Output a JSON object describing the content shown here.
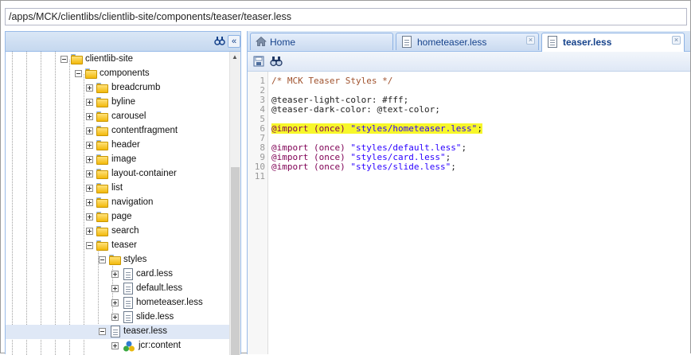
{
  "path": "/apps/MCK/clientlibs/clientlib-site/components/teaser/teaser.less",
  "tree": {
    "root_label": "clientlib-site",
    "components_label": "components",
    "folders": [
      "breadcrumb",
      "byline",
      "carousel",
      "contentfragment",
      "header",
      "image",
      "layout-container",
      "list",
      "navigation",
      "page",
      "search"
    ],
    "teaser_label": "teaser",
    "styles_label": "styles",
    "style_files": [
      "card.less",
      "default.less",
      "hometeaser.less",
      "slide.less"
    ],
    "selected_file": "teaser.less",
    "jcr_label": "jcr:content"
  },
  "tabs": [
    {
      "label": "Home",
      "icon": "home-icon",
      "closable": false,
      "active": false
    },
    {
      "label": "hometeaser.less",
      "icon": "file-icon",
      "closable": true,
      "active": false
    },
    {
      "label": "teaser.less",
      "icon": "file-icon",
      "closable": true,
      "active": true
    }
  ],
  "toolbar": {
    "icons": [
      "save-icon",
      "find-icon"
    ]
  },
  "editor": {
    "line_numbers": [
      "1",
      "2",
      "3",
      "4",
      "5",
      "6",
      "7",
      "8",
      "9",
      "10",
      "11"
    ],
    "lines": [
      {
        "kind": "comment",
        "text": "/* MCK Teaser Styles */"
      },
      {
        "kind": "plain",
        "text": ""
      },
      {
        "kind": "plain",
        "text": "@teaser-light-color: #fff;"
      },
      {
        "kind": "plain",
        "text": "@teaser-dark-color: @text-color;"
      },
      {
        "kind": "plain",
        "text": ""
      },
      {
        "kind": "import",
        "keyword": "@import",
        "mode": "(once)",
        "value": "\"styles/hometeaser.less\"",
        "end": ";",
        "highlight": true
      },
      {
        "kind": "plain",
        "text": ""
      },
      {
        "kind": "import",
        "keyword": "@import",
        "mode": "(once)",
        "value": "\"styles/default.less\"",
        "end": ";"
      },
      {
        "kind": "import",
        "keyword": "@import",
        "mode": "(once)",
        "value": "\"styles/card.less\"",
        "end": ";"
      },
      {
        "kind": "import",
        "keyword": "@import",
        "mode": "(once)",
        "value": "\"styles/slide.less\"",
        "end": ";"
      },
      {
        "kind": "plain",
        "text": ""
      }
    ],
    "highlight_color": "#f7f72a"
  },
  "colors": {
    "accent": "#15428b",
    "panel_border": "#99bbe8"
  }
}
